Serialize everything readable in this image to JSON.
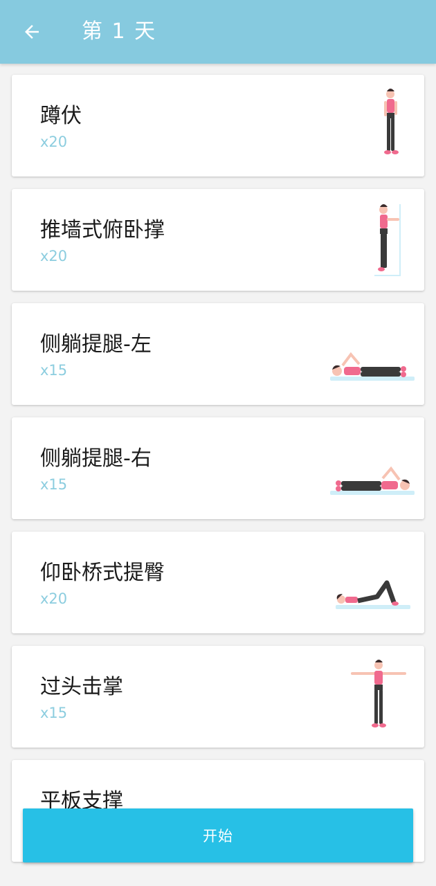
{
  "header": {
    "title": "第 1 天",
    "back_icon": "arrow-left-icon",
    "background_color": "#86cadf"
  },
  "exercises": [
    {
      "name": "蹲伏",
      "reps": "x20",
      "illustration": "standing-squat-figure"
    },
    {
      "name": "推墙式俯卧撑",
      "reps": "x20",
      "illustration": "wall-pushup-figure"
    },
    {
      "name": "侧躺提腿-左",
      "reps": "x15",
      "illustration": "side-lying-leg-lift-left-figure"
    },
    {
      "name": "侧躺提腿-右",
      "reps": "x15",
      "illustration": "side-lying-leg-lift-right-figure"
    },
    {
      "name": "仰卧桥式提臀",
      "reps": "x20",
      "illustration": "glute-bridge-figure"
    },
    {
      "name": "过头击掌",
      "reps": "x15",
      "illustration": "overhead-clap-figure"
    },
    {
      "name": "平板支撑",
      "reps": "",
      "illustration": "plank-figure"
    }
  ],
  "start_button": {
    "label": "开始",
    "color": "#27c0e6"
  },
  "colors": {
    "reps_text": "#8ccddf",
    "figure_top": "#f06a8e",
    "figure_pants": "#3a3a3a",
    "figure_skin": "#f7c3b3",
    "mat": "#cfeef8"
  }
}
